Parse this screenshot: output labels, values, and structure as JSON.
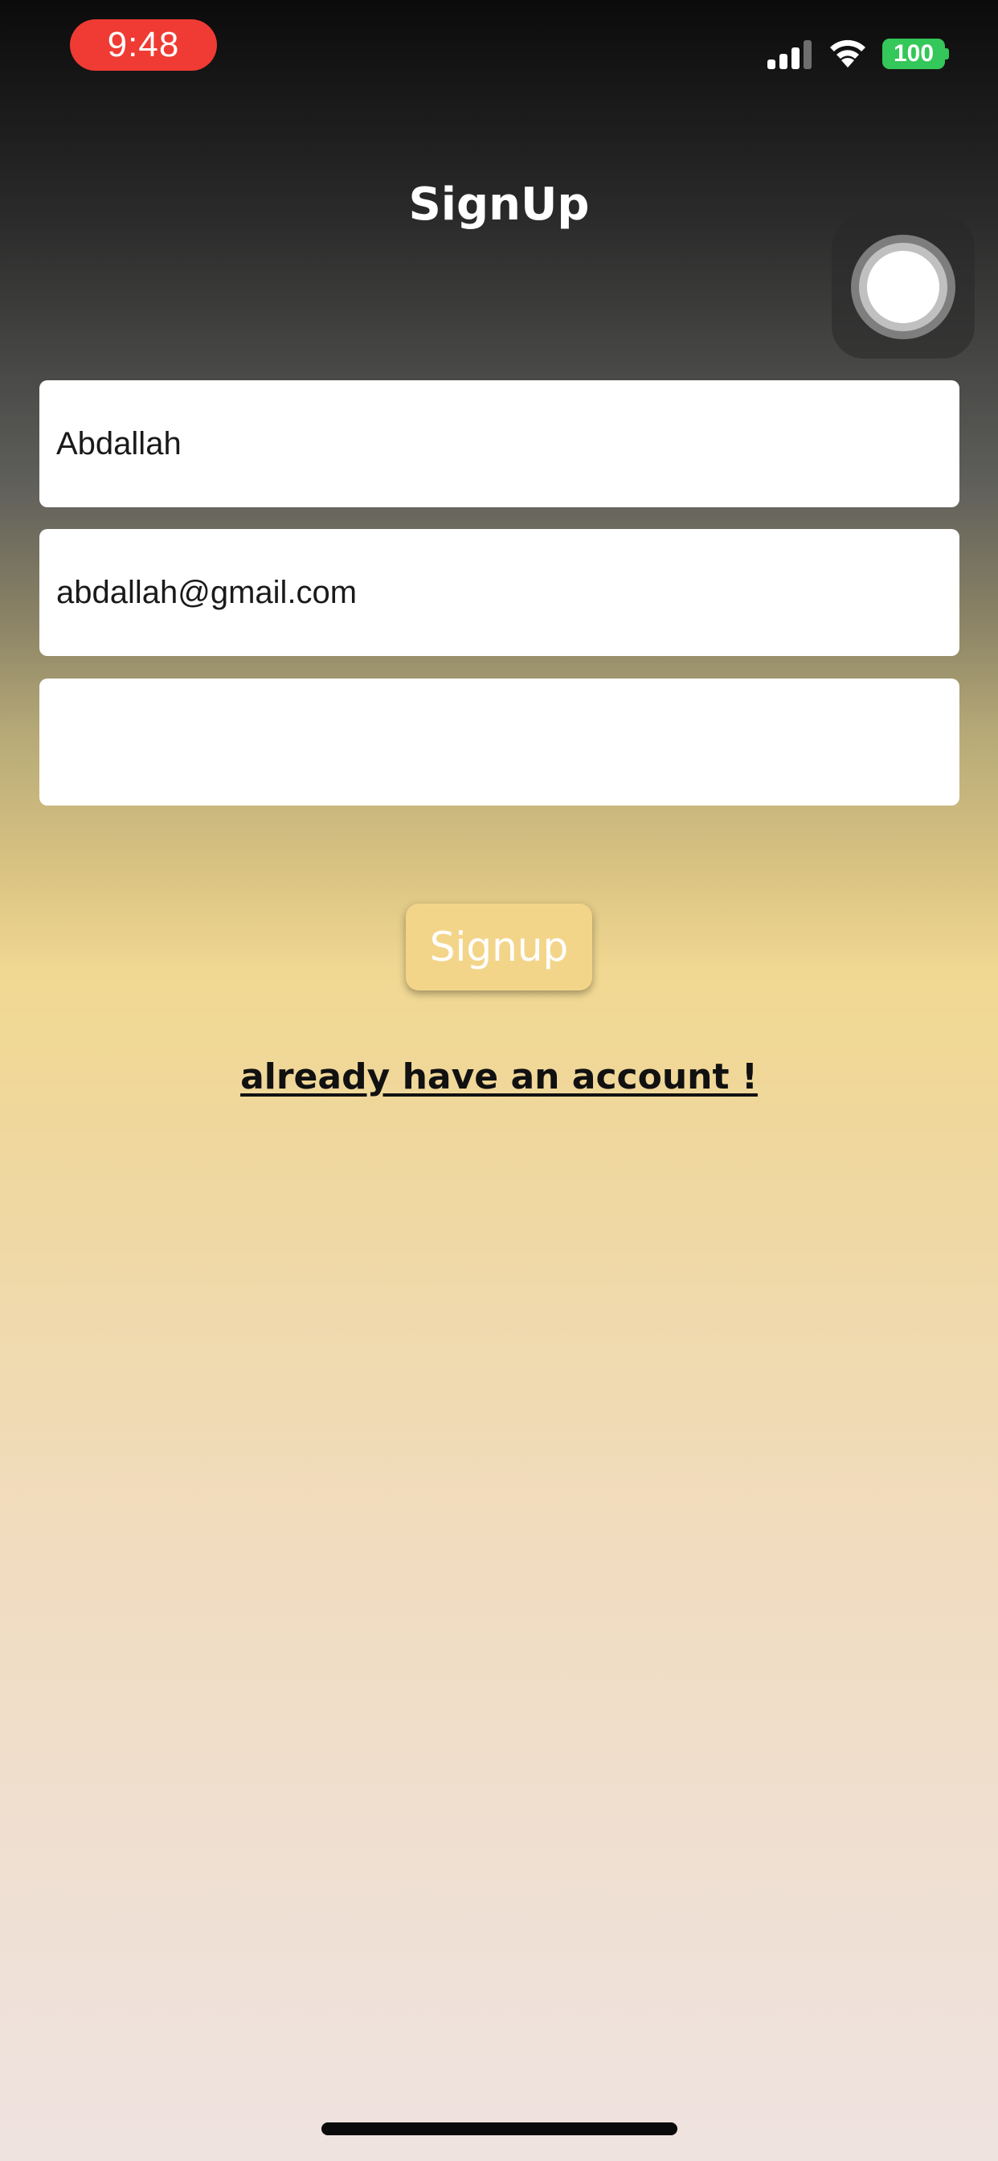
{
  "status_bar": {
    "time": "9:48",
    "battery_level": "100",
    "icons": [
      "signal-icon",
      "wifi-icon",
      "battery-icon"
    ],
    "time_pill_color": "#ef3b33",
    "battery_color": "#34c759"
  },
  "page": {
    "title": "SignUp"
  },
  "form": {
    "name_value": "Abdallah",
    "email_value": "abdallah@gmail.com",
    "password_value": ""
  },
  "actions": {
    "signup_label": "Signup",
    "login_link_label": "already have an account !",
    "signup_button_color": "#f3d58a"
  },
  "overlay": {
    "icon": "assistive-touch-icon"
  }
}
